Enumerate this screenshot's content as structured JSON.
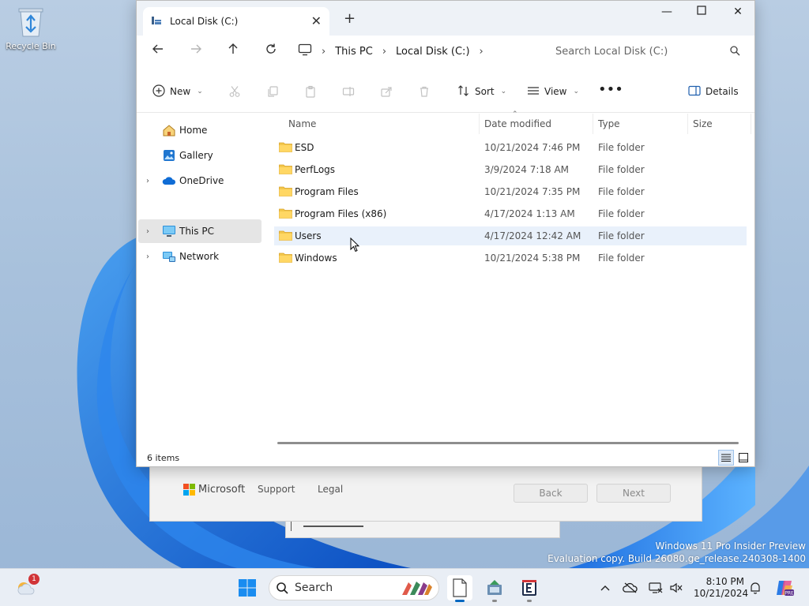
{
  "desktop": {
    "recycle_bin_label": "Recycle Bin",
    "watermark_line1": "Windows 11 Pro Insider Preview",
    "watermark_line2": "Evaluation copy. Build 26080.ge_release.240308-1400"
  },
  "background_window": {
    "brand": "Microsoft",
    "support_link": "Support",
    "legal_link": "Legal",
    "back_button": "Back",
    "next_button": "Next"
  },
  "explorer": {
    "tab_title": "Local Disk (C:)",
    "new_tab_icon": "plus-icon",
    "window_controls": {
      "minimize": "minimize-icon",
      "maximize": "maximize-icon",
      "close": "close-icon"
    },
    "nav": {
      "back": "arrow-left-icon",
      "forward": "arrow-right-icon",
      "up": "arrow-up-icon",
      "refresh": "refresh-icon"
    },
    "breadcrumb": [
      "This PC",
      "Local Disk (C:)"
    ],
    "search_placeholder": "Search Local Disk (C:)",
    "commands": {
      "new": "New",
      "sort": "Sort",
      "view": "View",
      "details": "Details"
    },
    "sidebar": [
      {
        "label": "Home",
        "icon": "home-icon",
        "expandable": false,
        "selected": false
      },
      {
        "label": "Gallery",
        "icon": "gallery-icon",
        "expandable": false,
        "selected": false
      },
      {
        "label": "OneDrive",
        "icon": "cloud-icon",
        "expandable": true,
        "selected": false
      },
      {
        "label": "This PC",
        "icon": "monitor-icon",
        "expandable": true,
        "selected": true
      },
      {
        "label": "Network",
        "icon": "network-icon",
        "expandable": true,
        "selected": false
      }
    ],
    "columns": {
      "name": "Name",
      "date": "Date modified",
      "type": "Type",
      "size": "Size"
    },
    "files": [
      {
        "name": "ESD",
        "date": "10/21/2024 7:46 PM",
        "type": "File folder"
      },
      {
        "name": "PerfLogs",
        "date": "3/9/2024 7:18 AM",
        "type": "File folder"
      },
      {
        "name": "Program Files",
        "date": "10/21/2024 7:35 PM",
        "type": "File folder"
      },
      {
        "name": "Program Files (x86)",
        "date": "4/17/2024 1:13 AM",
        "type": "File folder"
      },
      {
        "name": "Users",
        "date": "4/17/2024 12:42 AM",
        "type": "File folder"
      },
      {
        "name": "Windows",
        "date": "10/21/2024 5:38 PM",
        "type": "File folder"
      }
    ],
    "hovered_file": "Users",
    "status_text": "6 items"
  },
  "taskbar": {
    "search_label": "Search",
    "notification_badge": "1",
    "time": "8:10 PM",
    "date": "10/21/2024"
  },
  "colors": {
    "accent": "#0067c0",
    "folder": "#f3c74b",
    "selection": "#e9f1fb"
  }
}
